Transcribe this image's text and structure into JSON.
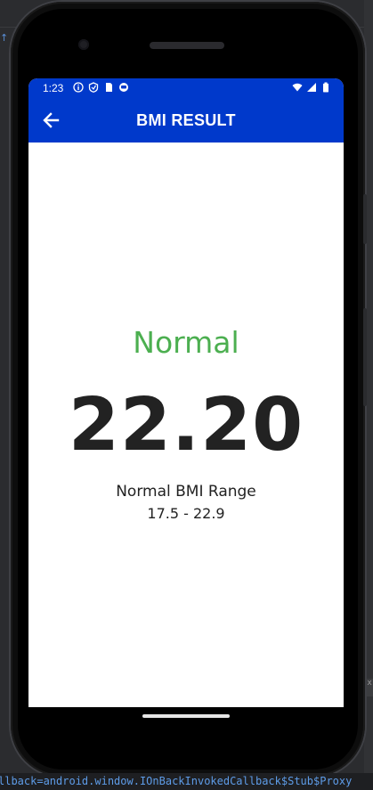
{
  "status_bar": {
    "time": "1:23"
  },
  "app_bar": {
    "title": "BMI RESULT"
  },
  "result": {
    "category": "Normal",
    "bmi_value": "22.20",
    "range_label": "Normal BMI Range",
    "range_value": "17.5 - 22.9"
  },
  "ide": {
    "log_text": "llback=android.window.IOnBackInvokedCallback$Stub$Proxy",
    "side_label": "ex"
  },
  "colors": {
    "app_bar": "#0039cb",
    "normal_status": "#4caf50",
    "value_text": "#222222",
    "log_text": "#5e9ce8"
  },
  "icons": {
    "status_left": [
      "info-icon",
      "shield-icon",
      "sim-card-icon",
      "face-icon"
    ],
    "status_right": [
      "wifi-icon",
      "signal-icon",
      "battery-icon"
    ],
    "app_bar": "back-arrow-icon"
  }
}
